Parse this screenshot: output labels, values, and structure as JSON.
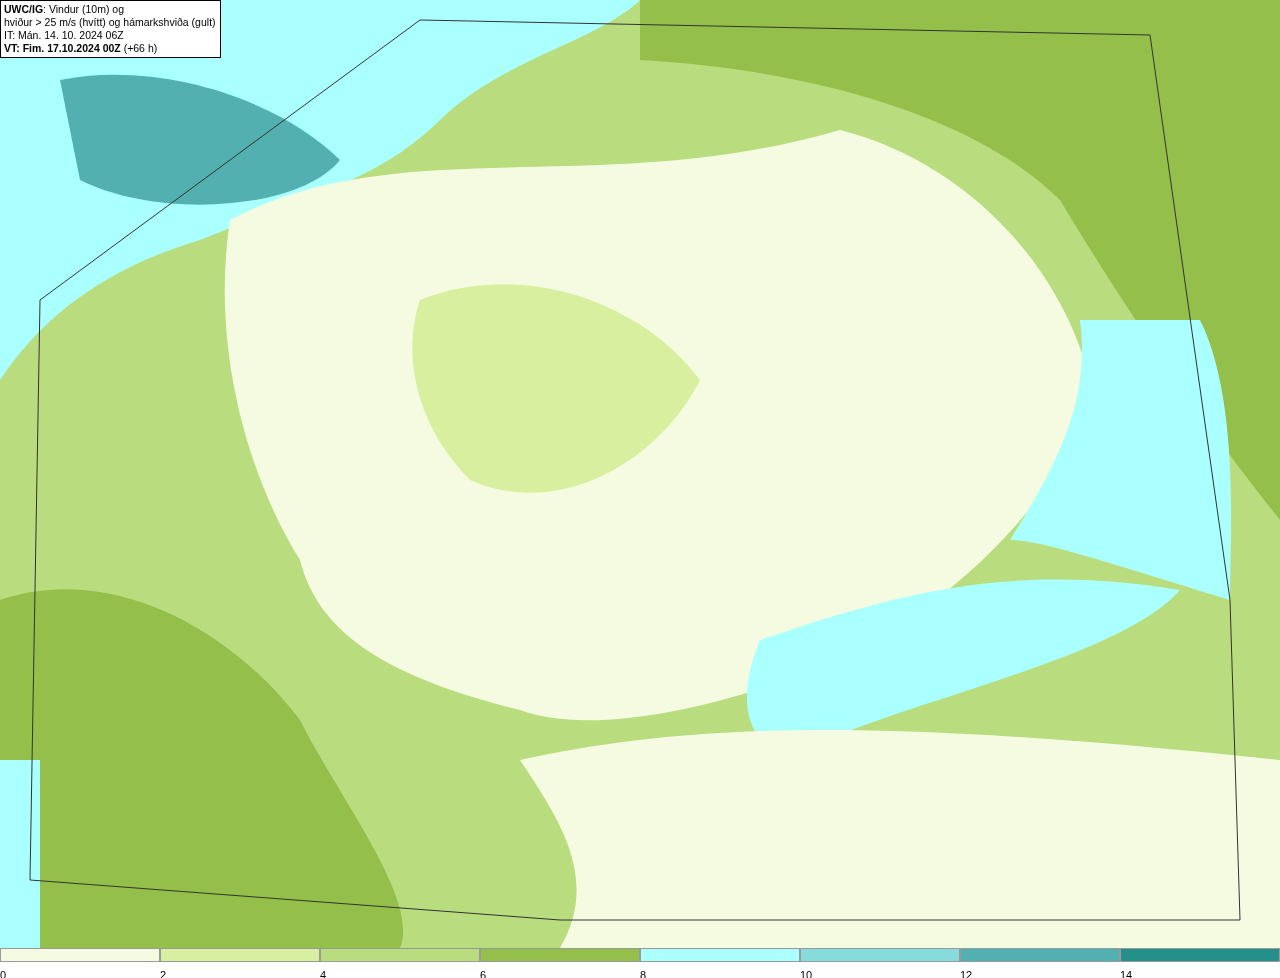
{
  "caption": {
    "lines": [
      "**UWC/IG**: Vindur (10m) og",
      "hviður > 25 m/s (hvítt) og hámarkshviða (gult)",
      "IT: Mán. 14. 10. 2024 06Z",
      "**VT: Fim. 17.10.2024 00Z** (+66 h)"
    ]
  },
  "legend": {
    "bins": [
      {
        "label": "0",
        "color": "#f5fbe0"
      },
      {
        "label": "2",
        "color": "#d8efa0"
      },
      {
        "label": "4",
        "color": "#b9dc7e"
      },
      {
        "label": "6",
        "color": "#93bf4a"
      },
      {
        "label": "8",
        "color": "#aaffff"
      },
      {
        "label": "10",
        "color": "#86dbdb"
      },
      {
        "label": "12",
        "color": "#52b0b0"
      },
      {
        "label": "14",
        "color": "#23908a"
      }
    ]
  }
}
